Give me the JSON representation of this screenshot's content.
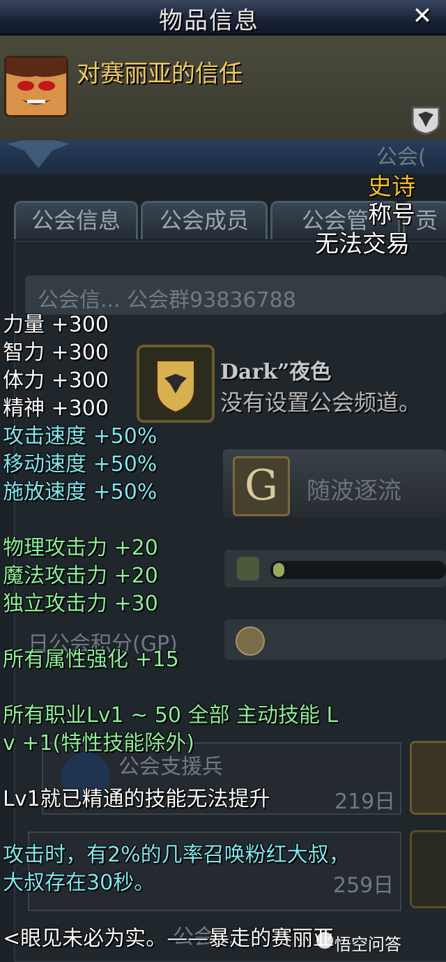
{
  "window": {
    "title": "物品信息",
    "close_label": "✕"
  },
  "item": {
    "name": "对赛丽亚的信任",
    "rarity": "史诗",
    "type": "称号",
    "trade": "无法交易"
  },
  "stats_white": [
    "力量 +300",
    "智力 +300",
    "体力 +300",
    "精神 +300"
  ],
  "stats_speed": [
    "攻击速度 +50%",
    "移动速度 +50%",
    "施放速度 +50%"
  ],
  "stats_attack": [
    "物理攻击力 +20",
    "魔法攻击力 +20",
    "独立攻击力 +30"
  ],
  "element": "所有属性强化 +15",
  "skill": {
    "line1": "所有职业Lv1 ~ 50 全部 主动技能 L",
    "line2": "v +1(特性技能除外)"
  },
  "skill_note": "Lv1就已精通的技能无法提升",
  "proc": {
    "line1": "攻击时，有2%的几率召唤粉红大叔，",
    "line2": "大叔存在30秒。"
  },
  "flavor": "<眼见未必为实。——暴走的赛丽亚",
  "background": {
    "guild_top_label": "公会(",
    "tabs": [
      "公会信息",
      "公会成员",
      "公会管"
    ],
    "tab_extra": "贡",
    "info_row": "公会信...   公会群93836788",
    "guild_name": "Dark”夜色",
    "no_channel": "没有设置公会频道。",
    "g_button_letter": "G",
    "g_button_label": "随波逐流",
    "points_label": "日公会积分(GP)",
    "support": "公会支援兵",
    "days_1": "219日",
    "days_2": "259日",
    "bottom_faint": "公会..."
  },
  "watermark": "悟空问答",
  "colors": {
    "title_bg": "#1a2236",
    "rarity": "#f0c020",
    "item_name": "#f0c860",
    "speed_text": "#7ee8f0",
    "attack_text": "#8cf09a"
  }
}
